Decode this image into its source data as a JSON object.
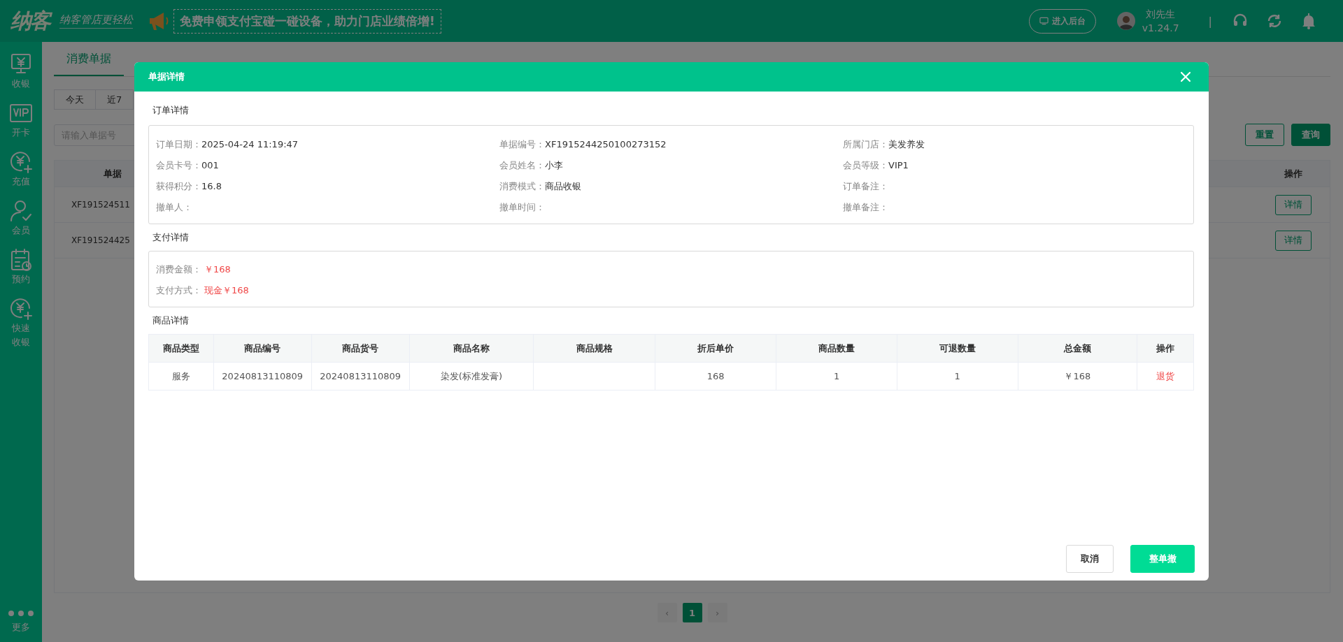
{
  "header": {
    "logo": "纳客",
    "slogan": "纳客管店更轻松",
    "banner": "免费申领支付宝碰一碰设备，助力门店业绩倍增!",
    "backend_button": "进入后台",
    "user_name": "刘先生",
    "version": "v1.24.7",
    "divider": "|"
  },
  "sidebar": {
    "items": [
      {
        "label": "收银",
        "kind": "cashier"
      },
      {
        "label": "开卡",
        "kind": "vip"
      },
      {
        "label": "充值",
        "kind": "recharge"
      },
      {
        "label": "会员",
        "kind": "member"
      },
      {
        "label": "预约",
        "kind": "booking"
      },
      {
        "label": "快速收银",
        "kind": "recharge"
      }
    ],
    "more": "更多"
  },
  "page": {
    "tabs": [
      {
        "label": "消费单据",
        "selected": true
      }
    ],
    "date_filters": [
      {
        "label": "今天",
        "selected": false
      },
      {
        "label": "近7",
        "selected": false
      }
    ],
    "search": {
      "placeholder": "请输入单据号"
    },
    "buttons": [
      {
        "label": "重置",
        "kind": "secondary"
      },
      {
        "label": "查询",
        "kind": "primary"
      }
    ],
    "table": {
      "columns": [
        "单据",
        "操作"
      ],
      "rows": [
        {
          "order_no": "XF191524511",
          "action": "详情"
        },
        {
          "order_no": "XF191524425",
          "action": "详情"
        }
      ]
    },
    "pagination": {
      "prev": "‹",
      "pages": [
        {
          "label": "1",
          "selected": true
        }
      ],
      "next": "›"
    }
  },
  "dialog": {
    "title": "单据详情",
    "order_details": {
      "title": "订单详情",
      "fields": [
        {
          "label": "订单日期：",
          "value": "2025-04-24 11:19:47"
        },
        {
          "label": "单据编号：",
          "value": "XF1915244250100273152"
        },
        {
          "label": "所属门店：",
          "value": "美发养发"
        },
        {
          "label": "会员卡号：",
          "value": "001"
        },
        {
          "label": "会员姓名：",
          "value": "小李"
        },
        {
          "label": "会员等级：",
          "value": "VIP1"
        },
        {
          "label": "获得积分：",
          "value": "16.8"
        },
        {
          "label": "消费模式：",
          "value": "商品收银"
        },
        {
          "label": "订单备注："
        },
        {
          "label": "撤单人："
        },
        {
          "label": "撤单时间："
        },
        {
          "label": "撤单备注："
        }
      ]
    },
    "payment_details": {
      "title": "支付详情",
      "fields": [
        {
          "label": "消费金额：",
          "value": "￥168"
        },
        {
          "label": "支付方式：",
          "value": "现金￥168"
        }
      ]
    },
    "product_details": {
      "title": "商品详情",
      "columns": [
        "商品类型",
        "商品编号",
        "商品货号",
        "商品名称",
        "商品规格",
        "折后单价",
        "商品数量",
        "可退数量",
        "总金额",
        "操作"
      ],
      "rows": [
        {
          "type": "服务",
          "code": "20240813110809",
          "sku": "20240813110809",
          "name": "染发(标准发膏)",
          "unit_price": "168",
          "quantity": "1",
          "refundable": "1",
          "total": "￥168",
          "action": "退货"
        }
      ]
    },
    "footer_buttons": [
      {
        "label": "取消",
        "kind": "secondary"
      },
      {
        "label": "整单撤",
        "kind": "primary"
      }
    ]
  }
}
